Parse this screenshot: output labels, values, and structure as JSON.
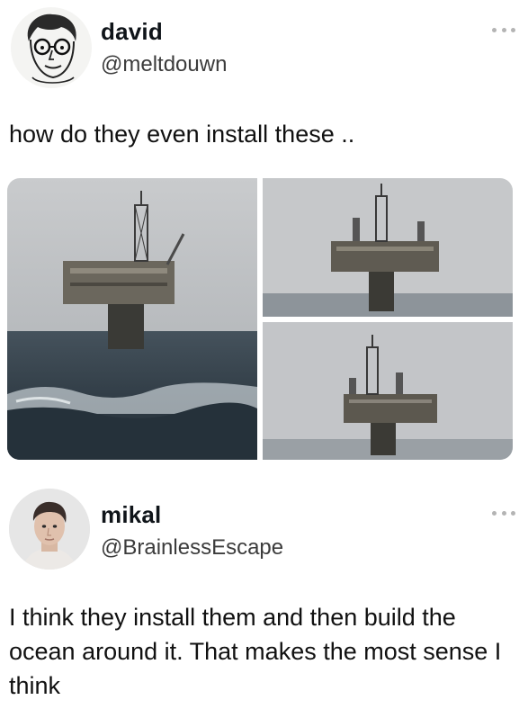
{
  "posts": [
    {
      "author": {
        "display_name": "david",
        "handle": "@meltdouwn",
        "avatar_icon": "sketched-face-with-glasses-icon"
      },
      "more_icon": "more-options-icon",
      "text": "how do they even install these ..",
      "media": [
        {
          "description": "offshore oil platform in rough sea, large view"
        },
        {
          "description": "offshore oil platform in fog"
        },
        {
          "description": "offshore oil platform in fog, calm sea"
        }
      ]
    },
    {
      "author": {
        "display_name": "mikal",
        "handle": "@BrainlessEscape",
        "avatar_icon": "profile-photo-icon"
      },
      "more_icon": "more-options-icon",
      "text": "I think they install them and then build the ocean around it. That makes the most sense I think"
    }
  ],
  "colors": {
    "text": "#0f1419",
    "secondary_text": "#3c3c3c",
    "more_dots": "#b4b4b4",
    "sky": "#b9bbbd",
    "sea": "#2e3a45"
  }
}
